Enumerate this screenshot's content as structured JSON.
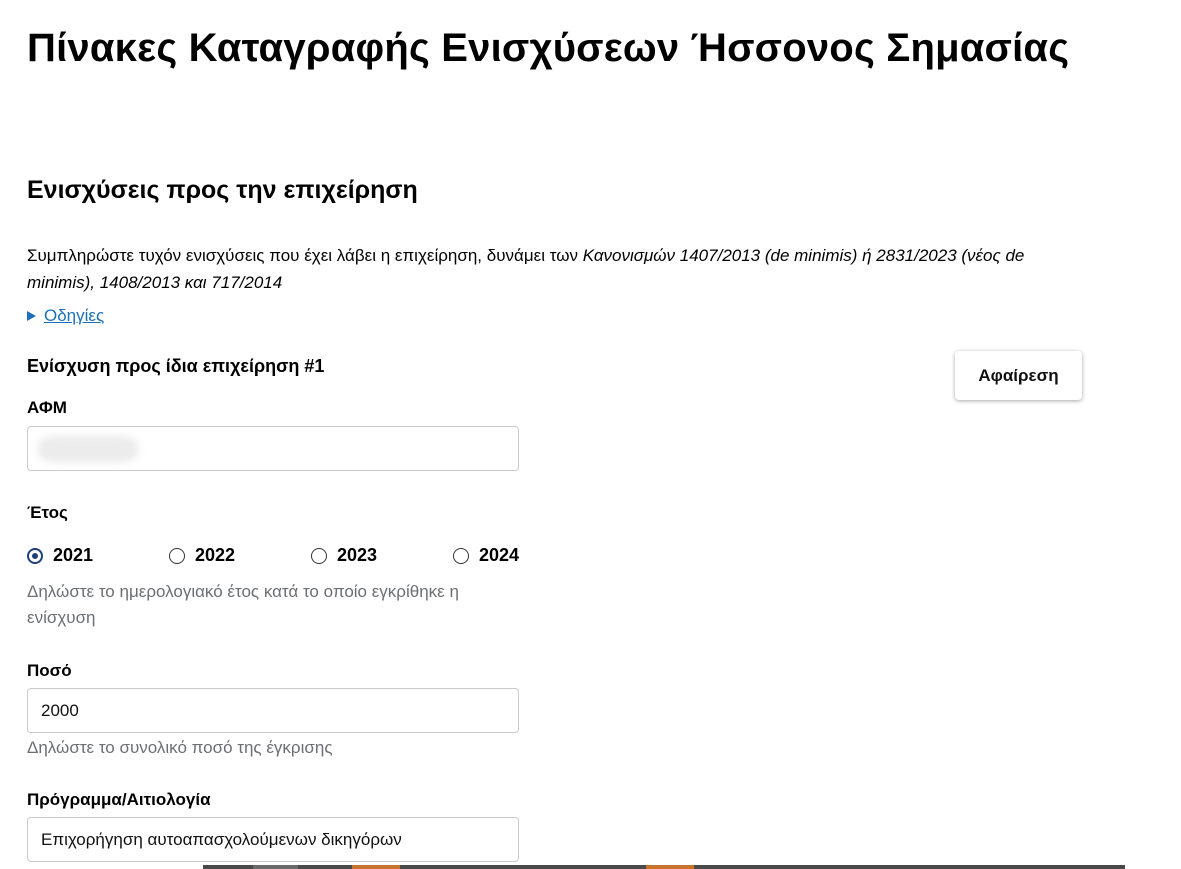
{
  "page": {
    "title": "Πίνακες Καταγραφής Ενισχύσεων Ήσσονος Σημασίας"
  },
  "section": {
    "title": "Ενισχύσεις προς την επιχείρηση",
    "intro_plain_1": "Συμπληρώστε τυχόν ενισχύσεις που έχει λάβει η επιχείρηση, δυνάμει των ",
    "intro_italic": "Κανονισμών 1407/2013 (de minimis) ή 2831/2023 (νέος de minimis), 1408/2013 και 717/2014",
    "guide_link": "Οδηγίες"
  },
  "entry": {
    "title": "Ενίσχυση προς ίδια επιχείρηση #1",
    "remove_label": "Αφαίρεση",
    "afm": {
      "label": "ΑΦΜ",
      "value": ""
    },
    "year": {
      "label": "Έτος",
      "options": [
        "2021",
        "2022",
        "2023",
        "2024"
      ],
      "selected": "2021",
      "hint": "Δηλώστε το ημερολογιακό έτος κατά το οποίο εγκρίθηκε η ενίσχυση"
    },
    "amount": {
      "label": "Ποσό",
      "value": "2000",
      "hint": "Δηλώστε το συνολικό ποσό της έγκρισης"
    },
    "program": {
      "label": "Πρόγραμμα/Αιτιολογία",
      "value": "Επιχορήγηση αυτοαπασχολούμενων δικηγόρων"
    }
  },
  "colors": {
    "link": "#1d70b8",
    "radio_selected": "#1e3f7a",
    "hint_text": "#6b6f73",
    "strip_orange": "#c8732e"
  }
}
